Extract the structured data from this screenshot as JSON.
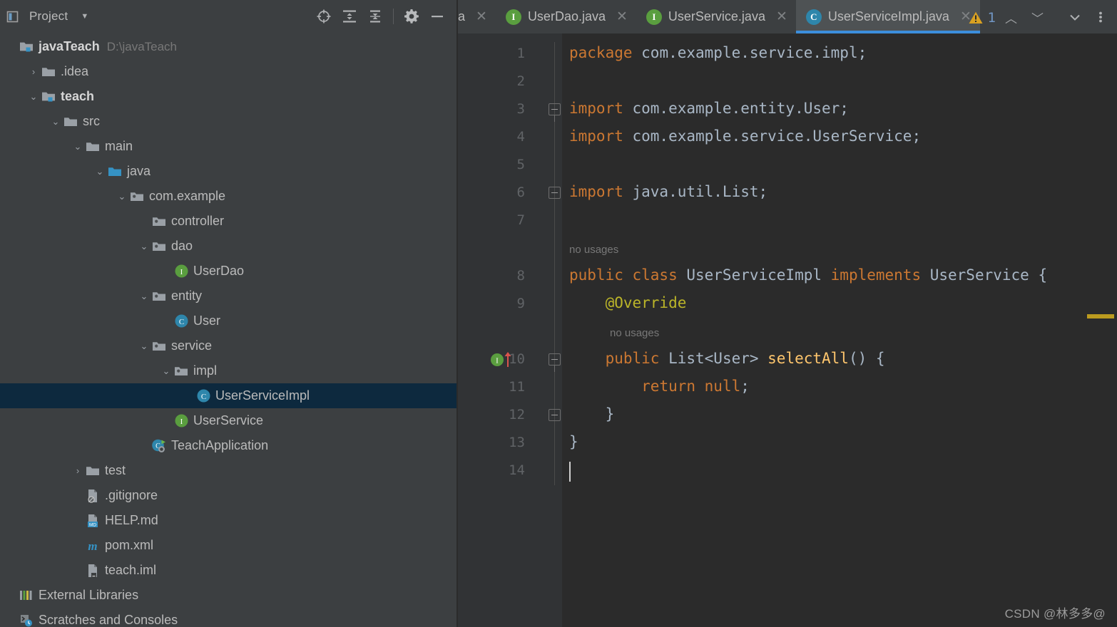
{
  "sidebar": {
    "panel_title": "Project",
    "caret_icon": "chevron-down-icon",
    "tools": [
      {
        "name": "locate-icon",
        "label": "Select Opened File"
      },
      {
        "name": "expand-all-icon",
        "label": "Expand All"
      },
      {
        "name": "collapse-all-icon",
        "label": "Collapse All"
      },
      {
        "name": "gear-icon",
        "label": "Settings"
      },
      {
        "name": "minimize-icon",
        "label": "Hide"
      }
    ],
    "tree": [
      {
        "label": "javaTeach",
        "sublabel": "D:\\javaTeach",
        "icon": "module-folder-icon",
        "arrow": "none",
        "indent": 0,
        "bold": true,
        "selected": false
      },
      {
        "label": ".idea",
        "sublabel": "",
        "icon": "folder-icon",
        "arrow": "collapsed",
        "indent": 1,
        "bold": false,
        "selected": false
      },
      {
        "label": "teach",
        "sublabel": "",
        "icon": "module-folder-icon",
        "arrow": "expanded",
        "indent": 1,
        "bold": true,
        "selected": false
      },
      {
        "label": "src",
        "sublabel": "",
        "icon": "folder-icon",
        "arrow": "expanded",
        "indent": 2,
        "bold": false,
        "selected": false
      },
      {
        "label": "main",
        "sublabel": "",
        "icon": "folder-icon",
        "arrow": "expanded",
        "indent": 3,
        "bold": false,
        "selected": false
      },
      {
        "label": "java",
        "sublabel": "",
        "icon": "source-root-folder-icon",
        "arrow": "expanded",
        "indent": 4,
        "bold": false,
        "selected": false
      },
      {
        "label": "com.example",
        "sublabel": "",
        "icon": "package-icon",
        "arrow": "expanded",
        "indent": 5,
        "bold": false,
        "selected": false
      },
      {
        "label": "controller",
        "sublabel": "",
        "icon": "package-icon",
        "arrow": "none",
        "indent": 6,
        "bold": false,
        "selected": false
      },
      {
        "label": "dao",
        "sublabel": "",
        "icon": "package-icon",
        "arrow": "expanded",
        "indent": 6,
        "bold": false,
        "selected": false
      },
      {
        "label": "UserDao",
        "sublabel": "",
        "icon": "interface-icon",
        "arrow": "none",
        "indent": 7,
        "bold": false,
        "selected": false
      },
      {
        "label": "entity",
        "sublabel": "",
        "icon": "package-icon",
        "arrow": "expanded",
        "indent": 6,
        "bold": false,
        "selected": false
      },
      {
        "label": "User",
        "sublabel": "",
        "icon": "class-icon",
        "arrow": "none",
        "indent": 7,
        "bold": false,
        "selected": false
      },
      {
        "label": "service",
        "sublabel": "",
        "icon": "package-icon",
        "arrow": "expanded",
        "indent": 6,
        "bold": false,
        "selected": false
      },
      {
        "label": "impl",
        "sublabel": "",
        "icon": "package-icon",
        "arrow": "expanded",
        "indent": 7,
        "bold": false,
        "selected": false
      },
      {
        "label": "UserServiceImpl",
        "sublabel": "",
        "icon": "class-icon",
        "arrow": "none",
        "indent": 8,
        "bold": false,
        "selected": true
      },
      {
        "label": "UserService",
        "sublabel": "",
        "icon": "interface-icon",
        "arrow": "none",
        "indent": 7,
        "bold": false,
        "selected": false
      },
      {
        "label": "TeachApplication",
        "sublabel": "",
        "icon": "spring-boot-class-icon",
        "arrow": "none",
        "indent": 6,
        "bold": false,
        "selected": false
      },
      {
        "label": "test",
        "sublabel": "",
        "icon": "folder-icon",
        "arrow": "collapsed",
        "indent": 3,
        "bold": false,
        "selected": false
      },
      {
        "label": ".gitignore",
        "sublabel": "",
        "icon": "gitignore-file-icon",
        "arrow": "none",
        "indent": 3,
        "bold": false,
        "selected": false
      },
      {
        "label": "HELP.md",
        "sublabel": "",
        "icon": "markdown-file-icon",
        "arrow": "none",
        "indent": 3,
        "bold": false,
        "selected": false
      },
      {
        "label": "pom.xml",
        "sublabel": "",
        "icon": "maven-file-icon",
        "arrow": "none",
        "indent": 3,
        "bold": false,
        "selected": false
      },
      {
        "label": "teach.iml",
        "sublabel": "",
        "icon": "iml-file-icon",
        "arrow": "none",
        "indent": 3,
        "bold": false,
        "selected": false
      },
      {
        "label": "External Libraries",
        "sublabel": "",
        "icon": "libraries-icon",
        "arrow": "none",
        "indent": 0,
        "bold": false,
        "selected": false
      },
      {
        "label": "Scratches and Consoles",
        "sublabel": "",
        "icon": "scratches-icon",
        "arrow": "none",
        "indent": 0,
        "bold": false,
        "selected": false
      }
    ]
  },
  "editor": {
    "tabs": [
      {
        "label": "a",
        "icon": "none",
        "active": false,
        "cut": true
      },
      {
        "label": "UserDao.java",
        "icon": "interface-icon",
        "active": false,
        "cut": false
      },
      {
        "label": "UserService.java",
        "icon": "interface-icon",
        "active": false,
        "cut": false
      },
      {
        "label": "UserServiceImpl.java",
        "icon": "class-icon",
        "active": true,
        "cut": false
      }
    ],
    "tabbar_right": [
      {
        "name": "chevron-down-icon"
      },
      {
        "name": "more-options-icon"
      }
    ],
    "inspection": {
      "warn_icon": "warning-triangle-icon",
      "warn_count": "1",
      "prev_icon": "chevron-up-icon",
      "next_icon": "chevron-down-icon"
    },
    "line_numbers": [
      "1",
      "2",
      "3",
      "4",
      "5",
      "6",
      "7",
      "8",
      "9",
      "10",
      "11",
      "12",
      "13",
      "14"
    ],
    "hints": [
      {
        "text": "no usages",
        "line": 8,
        "indent": 0
      },
      {
        "text": "no usages",
        "line": 10,
        "indent": 1
      }
    ],
    "gutter_marker": {
      "name": "implementing-method-icon",
      "letter": "I",
      "line": 10
    },
    "code_lines": [
      {
        "n": 1,
        "tokens": [
          {
            "t": "package",
            "c": "kw"
          },
          {
            "t": " com.example.service.impl;",
            "c": "plain"
          }
        ]
      },
      {
        "n": 2,
        "tokens": []
      },
      {
        "n": 3,
        "tokens": [
          {
            "t": "import",
            "c": "kw"
          },
          {
            "t": " com.example.entity.User;",
            "c": "plain"
          }
        ]
      },
      {
        "n": 4,
        "tokens": [
          {
            "t": "import",
            "c": "kw"
          },
          {
            "t": " com.example.service.UserService;",
            "c": "plain"
          }
        ]
      },
      {
        "n": 5,
        "tokens": []
      },
      {
        "n": 6,
        "tokens": [
          {
            "t": "import",
            "c": "kw"
          },
          {
            "t": " java.util.List;",
            "c": "plain"
          }
        ]
      },
      {
        "n": 7,
        "tokens": []
      },
      {
        "n": 8,
        "tokens": [
          {
            "t": "public class",
            "c": "kw"
          },
          {
            "t": " UserServiceImpl ",
            "c": "plain"
          },
          {
            "t": "implements",
            "c": "kw"
          },
          {
            "t": " UserService {",
            "c": "plain"
          }
        ]
      },
      {
        "n": 9,
        "tokens": [
          {
            "t": "    @Override",
            "c": "anno"
          }
        ]
      },
      {
        "n": 10,
        "tokens": [
          {
            "t": "    ",
            "c": "plain"
          },
          {
            "t": "public",
            "c": "kw"
          },
          {
            "t": " List<User> ",
            "c": "plain"
          },
          {
            "t": "selectAll",
            "c": "meth"
          },
          {
            "t": "() {",
            "c": "plain"
          }
        ]
      },
      {
        "n": 11,
        "tokens": [
          {
            "t": "        ",
            "c": "plain"
          },
          {
            "t": "return null",
            "c": "kw"
          },
          {
            "t": ";",
            "c": "plain"
          }
        ]
      },
      {
        "n": 12,
        "tokens": [
          {
            "t": "    }",
            "c": "plain"
          }
        ]
      },
      {
        "n": 13,
        "tokens": [
          {
            "t": "}",
            "c": "plain"
          }
        ]
      },
      {
        "n": 14,
        "tokens": []
      }
    ],
    "caret_line": 14,
    "scroll_marker_color": "#BC9B1F"
  },
  "watermark": "CSDN @林多多@",
  "colors": {
    "accent": "#3C8EDC",
    "keyword": "#CC7832",
    "annotation": "#BBB529",
    "method": "#FFC66D",
    "text": "#A9B7C6",
    "selection": "#0D293E",
    "warning": "#BC9B1F"
  }
}
